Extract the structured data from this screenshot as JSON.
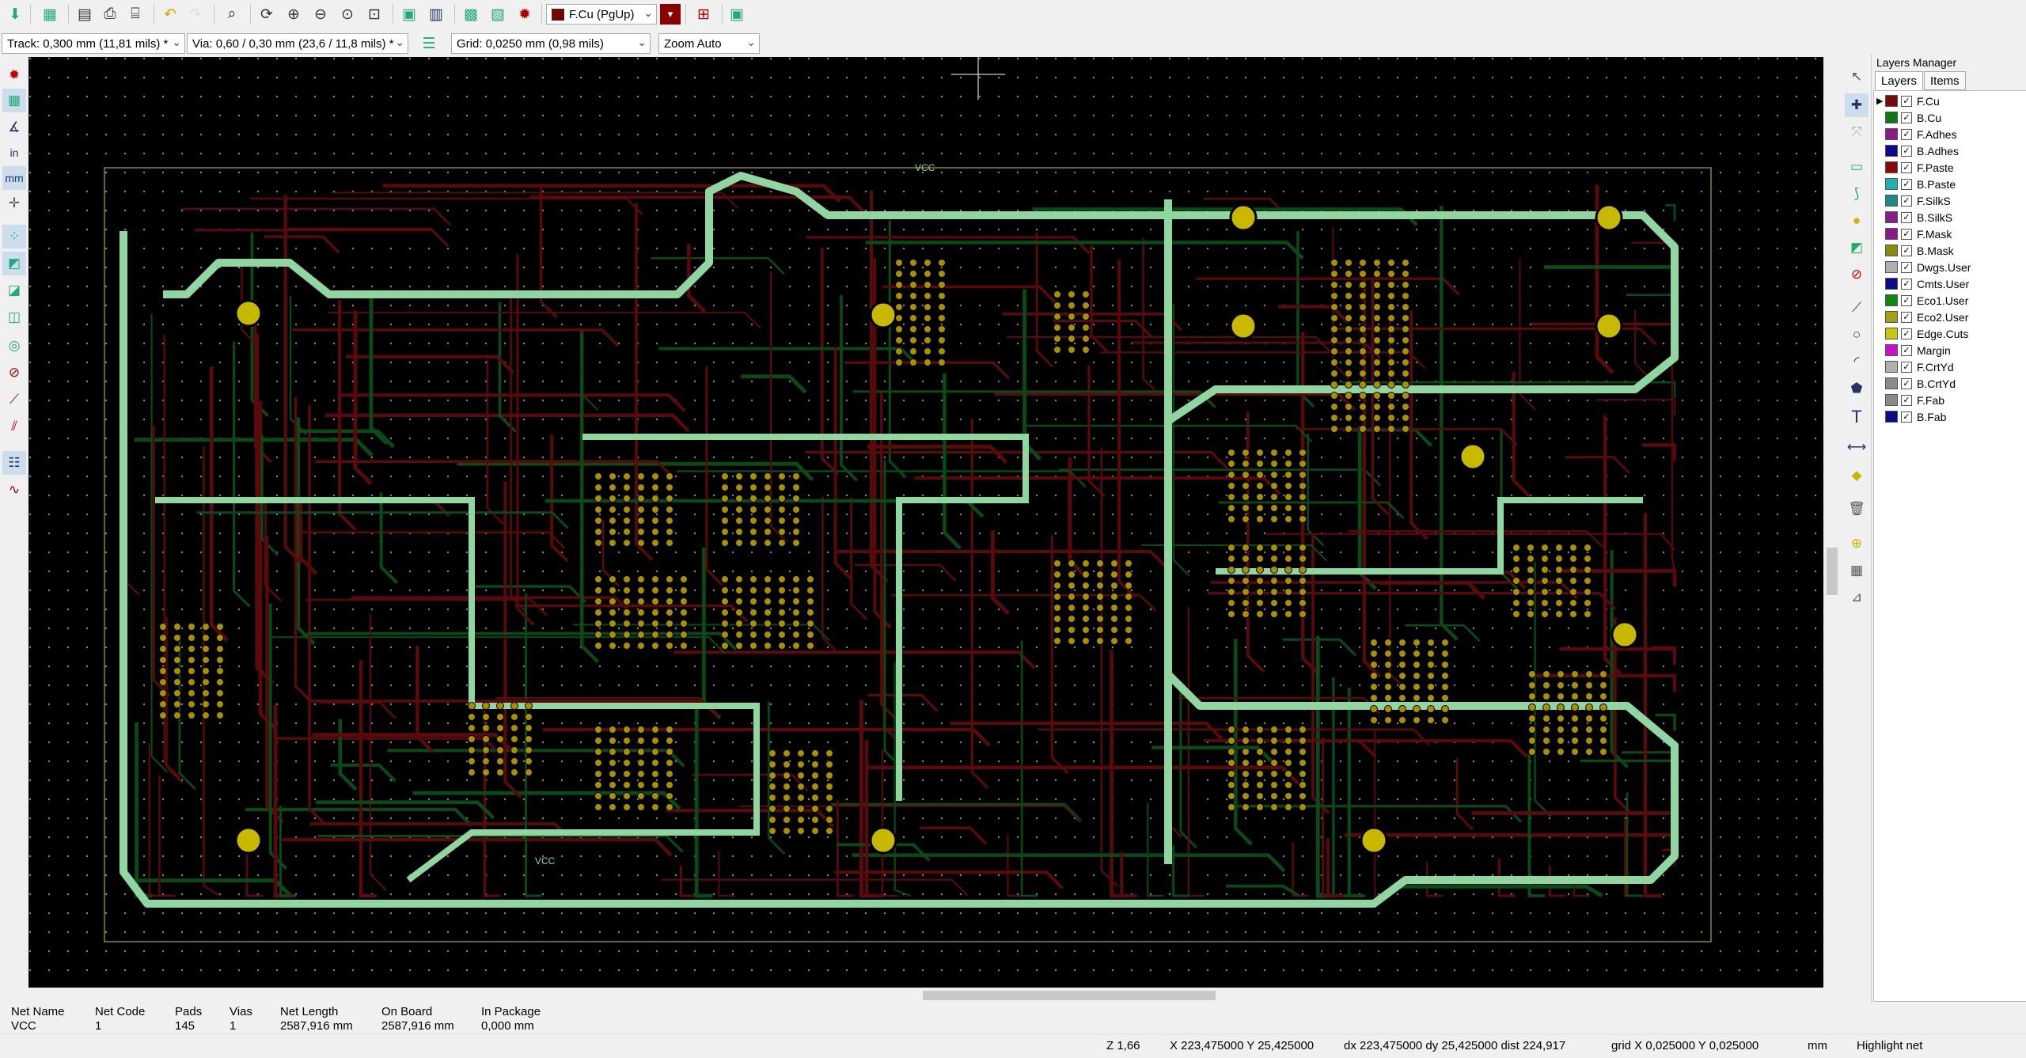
{
  "toolbar": {
    "layer_selector": "F.Cu (PgUp)",
    "layer_color": "#7a0000"
  },
  "toolbar2": {
    "track": "Track: 0,300 mm (11,81 mils) *",
    "via": "Via: 0,60 / 0,30 mm (23,6 / 11,8 mils) *",
    "grid": "Grid: 0,0250 mm (0,98 mils)",
    "zoom": "Zoom Auto"
  },
  "left_toolbar": {
    "units_in": "in",
    "units_mm": "mm"
  },
  "canvas": {
    "background": "#000000",
    "net_labels": [
      "VCC",
      "VCC"
    ]
  },
  "layers_manager": {
    "title": "Layers Manager",
    "tabs": [
      "Layers",
      "Items"
    ],
    "layers": [
      {
        "name": "F.Cu",
        "color": "#7a0a0a"
      },
      {
        "name": "B.Cu",
        "color": "#0a7a14"
      },
      {
        "name": "F.Adhes",
        "color": "#8a1a8a"
      },
      {
        "name": "B.Adhes",
        "color": "#0a0a8a"
      },
      {
        "name": "F.Paste",
        "color": "#8a0a0a"
      },
      {
        "name": "B.Paste",
        "color": "#20b0b0"
      },
      {
        "name": "F.SilkS",
        "color": "#1a8a8a"
      },
      {
        "name": "B.SilkS",
        "color": "#8a1a8a"
      },
      {
        "name": "F.Mask",
        "color": "#8a1a8a"
      },
      {
        "name": "B.Mask",
        "color": "#8a8a10"
      },
      {
        "name": "Dwgs.User",
        "color": "#b0b0b0"
      },
      {
        "name": "Cmts.User",
        "color": "#0a0a8a"
      },
      {
        "name": "Eco1.User",
        "color": "#0a8a0a"
      },
      {
        "name": "Eco2.User",
        "color": "#a0a010"
      },
      {
        "name": "Edge.Cuts",
        "color": "#c8c810"
      },
      {
        "name": "Margin",
        "color": "#c810c8"
      },
      {
        "name": "F.CrtYd",
        "color": "#b0b0b0"
      },
      {
        "name": "B.CrtYd",
        "color": "#8a8a8a"
      },
      {
        "name": "F.Fab",
        "color": "#8a8a8a"
      },
      {
        "name": "B.Fab",
        "color": "#0a0a8a"
      }
    ]
  },
  "net_info": {
    "headers": [
      "Net Name",
      "Net Code",
      "Pads",
      "Vias",
      "Net Length",
      "On Board",
      "In Package"
    ],
    "values": [
      "VCC",
      "1",
      "145",
      "1",
      "2587,916 mm",
      "2587,916 mm",
      "0,000 mm"
    ]
  },
  "status": {
    "zoom": "Z 1,66",
    "coords": "X 223,475000  Y 25,425000",
    "delta": "dx 223,475000  dy 25,425000  dist 224,917",
    "grid": "grid X 0,025000  Y 0,025000",
    "units": "mm",
    "mode": "Highlight net"
  }
}
